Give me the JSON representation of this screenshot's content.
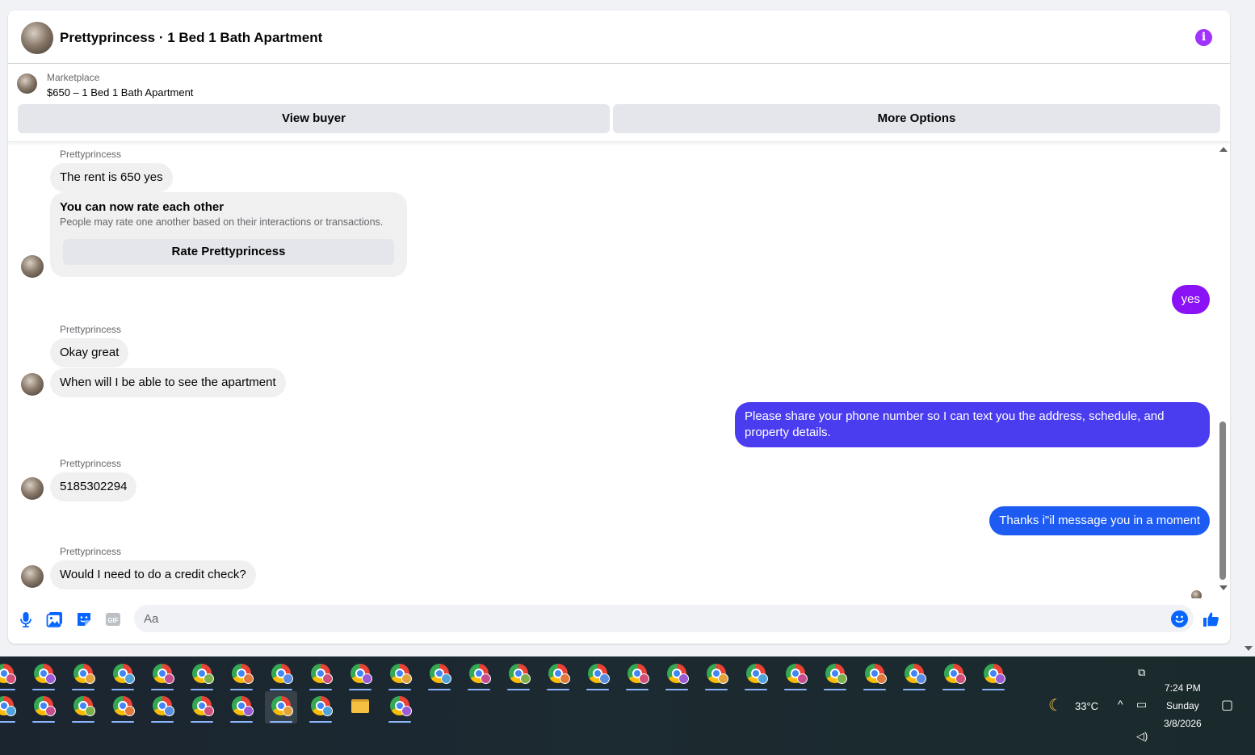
{
  "header": {
    "title": "Prettyprincess · 1 Bed 1 Bath Apartment",
    "info_icon_glyph": "i"
  },
  "listing": {
    "label": "Marketplace",
    "price_title": "$650 – 1 Bed 1 Bath Apartment",
    "view_buyer": "View buyer",
    "more_options": "More Options"
  },
  "thread": {
    "sender": "Prettyprincess",
    "messages": [
      {
        "from": "them",
        "text": "The rent is 650 yes"
      },
      {
        "from": "system",
        "title": "You can now rate each other",
        "subtitle": "People may rate one another based on their interactions or transactions.",
        "button": "Rate Prettyprincess"
      },
      {
        "from": "me",
        "text": "yes"
      },
      {
        "from": "them",
        "text": "Okay great"
      },
      {
        "from": "them",
        "text": "When will I be able to see the apartment"
      },
      {
        "from": "me",
        "text": "Please share your phone number so I can text you the address, schedule, and property details."
      },
      {
        "from": "them",
        "text": "5185302294"
      },
      {
        "from": "me",
        "text": "Thanks i\"il message you in a moment"
      },
      {
        "from": "them",
        "text": "Would I need to do a credit check?"
      }
    ]
  },
  "composer": {
    "placeholder": "Aa",
    "icons": [
      "microphone-icon",
      "photo-icon",
      "sticker-icon",
      "gif-icon",
      "emoji-icon",
      "thumbs-up-icon"
    ],
    "gif_label": "GIF"
  },
  "colors": {
    "accent_purple": "#a033ff",
    "out_bubble_1": "#8a12f5",
    "out_bubble_2": "#4a3df0",
    "out_bubble_3": "#1d5bf2",
    "like_blue": "#0866ff"
  },
  "taskbar": {
    "weather_temp": "33°C",
    "time": "7:24 PM",
    "day": "Sunday",
    "date": "3/8/2026"
  }
}
